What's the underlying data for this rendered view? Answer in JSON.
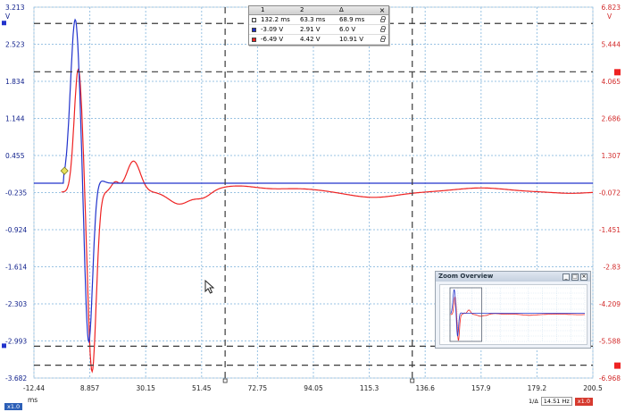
{
  "colors": {
    "ch_a": "#2233cc",
    "ch_b": "#ee2222",
    "grid": "#9ac3e3",
    "left_axis_text": "#0c1d8a",
    "right_axis_text": "#d22a2a",
    "ruler": "#3a3a3a"
  },
  "axes": {
    "left_unit": "V",
    "right_unit": "V",
    "x_unit": "ms",
    "left_ticks": [
      "3.213",
      "2.523",
      "1.834",
      "1.144",
      "0.455",
      "-0.235",
      "-0.924",
      "-1.614",
      "-2.303",
      "-2.993",
      "-3.682"
    ],
    "right_ticks": [
      "6.823",
      "5.444",
      "4.065",
      "2.686",
      "1.307",
      "-0.072",
      "-1.451",
      "-2.83",
      "-4.209",
      "-5.588",
      "-6.968"
    ],
    "x_ticks": [
      "-12.44",
      "8.857",
      "30.15",
      "51.45",
      "72.75",
      "94.05",
      "115.3",
      "136.6",
      "157.9",
      "179.2",
      "200.5"
    ],
    "x_range": [
      -12.44,
      200.5
    ],
    "left_range": [
      -3.682,
      3.213
    ],
    "right_range": [
      -6.968,
      6.823
    ]
  },
  "ruler_table": {
    "headers": [
      "1",
      "2",
      "Δ"
    ],
    "rows": [
      {
        "swatch": "white",
        "values": [
          "132.2 ms",
          "63.3 ms",
          "68.9 ms"
        ]
      },
      {
        "swatch": "blue",
        "values": [
          "-3.09 V",
          "2.91 V",
          "6.0 V"
        ]
      },
      {
        "swatch": "red",
        "values": [
          "-6.49 V",
          "4.42 V",
          "10.91 V"
        ]
      }
    ]
  },
  "rulers": {
    "time": [
      60.4,
      131.7
    ],
    "voltage_left": [
      2.91,
      -3.09
    ],
    "voltage_right": [
      4.42,
      -6.49
    ]
  },
  "channel_a_offset": -0.06,
  "zoom_overview": {
    "title": "Zoom Overview",
    "btn_min": "_",
    "btn_restore": "□",
    "btn_close": "×"
  },
  "status": {
    "x_badge": "x1.0",
    "freq_label": "1/Δ",
    "freq_value": "14.51 Hz",
    "y_badge": "x1.0"
  }
}
